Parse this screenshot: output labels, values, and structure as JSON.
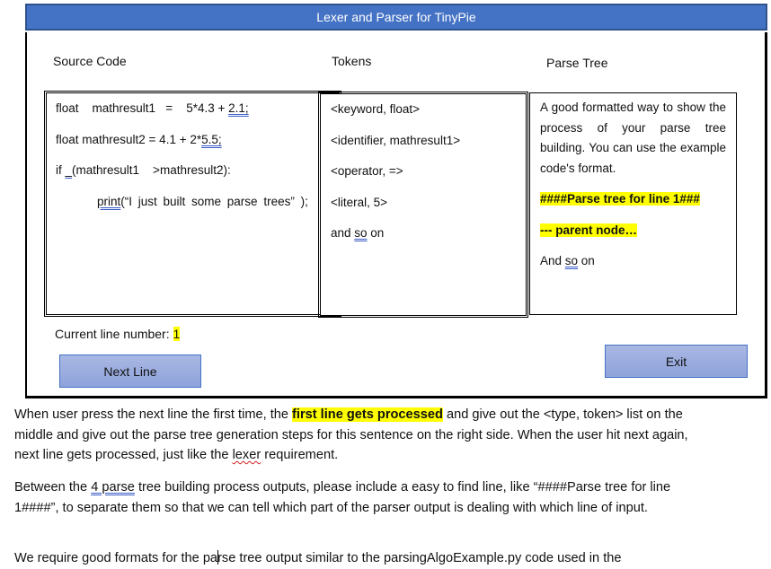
{
  "window": {
    "title": "Lexer and Parser for TinyPie",
    "colors": {
      "titlebar": "#4472c4",
      "titlebar_border": "#2f528f",
      "button_fill": "#9aaddf",
      "highlight": "#ffff00"
    },
    "columns": {
      "source_code": "Source Code",
      "tokens": "Tokens",
      "parse_tree": "Parse Tree"
    },
    "source_code": {
      "line1": {
        "a": "float    mathresult1   =    5*4.3 + ",
        "u": "2.1;"
      },
      "line2": {
        "a": "float mathresult2 = 4.1 + 2*",
        "u": "5.5;"
      },
      "line3": {
        "a": "if ",
        "u": "_",
        "b": "(mathresult1    >mathresult2):"
      },
      "line4": {
        "u": "print",
        "b": "(“I just built some parse trees”   );"
      }
    },
    "tokens": [
      "<keyword, float>",
      "<identifier, mathresult1>",
      "<operator, =>",
      "<literal, 5>"
    ],
    "tokens_more": {
      "a": "and ",
      "u": "so",
      "b": " on"
    },
    "parse_tree": {
      "description": "A good formatted way to show the process of your parse tree building. You can use the example code's format.",
      "header_line": "####Parse tree for line 1###",
      "node_line": "--- parent node…",
      "more": {
        "a": "And ",
        "u": "so",
        "b": " on"
      }
    },
    "current_line": {
      "label": "Current line number: ",
      "value": "1"
    },
    "buttons": {
      "next_line": "Next Line",
      "exit": "Exit"
    }
  },
  "document": {
    "para1": {
      "a": "When user press the next line the first time, the ",
      "hl": "first line gets processed",
      "b": " and give out the <type, token> list on the middle and give out the parse tree generation steps for this sentence on the right side. When the user hit next again, next line gets processed, just like the ",
      "sq": "lexer",
      "c": " requirement."
    },
    "para2": {
      "a": "Between the ",
      "u": "4 parse",
      "b": " tree building process outputs, please include a easy to find line, like “####Parse tree for line 1####”, to separate them so that we can tell which part of the parser output is dealing with which line of input."
    },
    "para3": {
      "a": "We require good formats for the pa",
      "b": "rse tree output similar to the parsingAlgoExample.py code used in the"
    }
  }
}
